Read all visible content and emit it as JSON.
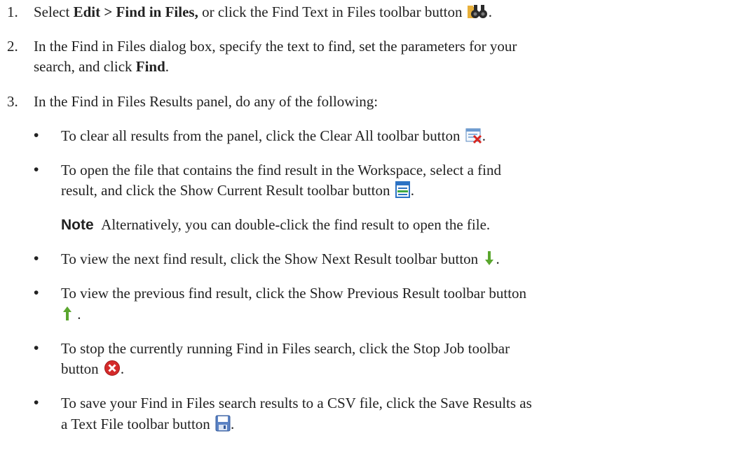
{
  "steps": [
    {
      "number": "1.",
      "pre": "Select ",
      "bold": "Edit > Find in Files,",
      "post": " or click the Find Text in Files toolbar button",
      "icon": "binoculars-icon"
    },
    {
      "number": "2.",
      "line1": "In the Find in Files dialog box, specify the text to find, set the parameters for your",
      "line2_pre": "search, and click ",
      "line2_bold": "Find",
      "line2_post": "."
    },
    {
      "number": "3.",
      "text": "In the Find in Files Results panel, do any of the following:"
    }
  ],
  "bullets": [
    {
      "lines": [
        "To clear all results from the panel, click the Clear All toolbar button"
      ],
      "icon": "clear-all-icon"
    },
    {
      "lines": [
        "To open the file that contains the find result in the Workspace, select a find",
        "result, and click the Show Current Result toolbar button"
      ],
      "icon": "show-current-result-icon"
    },
    {
      "lines": [
        "To view the next find result, click the Show Next Result toolbar button"
      ],
      "icon": "arrow-down-icon"
    },
    {
      "lines": [
        "To view the previous find result, click the Show Previous Result toolbar button"
      ],
      "icon": "arrow-up-icon"
    },
    {
      "lines": [
        "To stop the currently running Find in Files search, click the Stop Job toolbar",
        "button"
      ],
      "icon": "stop-icon"
    },
    {
      "lines": [
        "To save your Find in Files search results to a CSV file, click the Save Results as",
        "a Text File toolbar button"
      ],
      "icon": "save-icon"
    }
  ],
  "note": {
    "label": "Note",
    "text": "Alternatively, you can double-click the find result to open the file."
  },
  "bullet_char": "•",
  "period": "."
}
